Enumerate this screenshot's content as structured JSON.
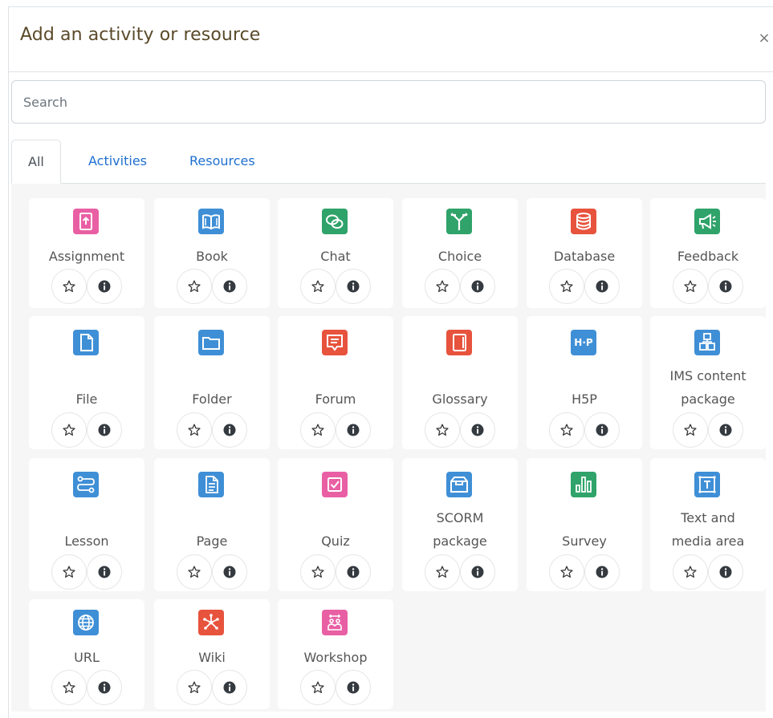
{
  "modal": {
    "title": "Add an activity or resource",
    "close_label": "×"
  },
  "search": {
    "placeholder": "Search",
    "value": ""
  },
  "tabs": [
    {
      "label": "All",
      "active": true
    },
    {
      "label": "Activities",
      "active": false
    },
    {
      "label": "Resources",
      "active": false
    }
  ],
  "colors": {
    "pink": "#e95fa4",
    "blue": "#3f8fd6",
    "green": "#2fa36a",
    "red": "#e7533d",
    "link": "#1f6fd1"
  },
  "modules": [
    {
      "name": "Assignment",
      "icon": "assignment-icon",
      "color": "#e95fa4"
    },
    {
      "name": "Book",
      "icon": "book-icon",
      "color": "#3f8fd6"
    },
    {
      "name": "Chat",
      "icon": "chat-icon",
      "color": "#2fa36a"
    },
    {
      "name": "Choice",
      "icon": "choice-icon",
      "color": "#2fa36a"
    },
    {
      "name": "Database",
      "icon": "database-icon",
      "color": "#e7533d"
    },
    {
      "name": "Feedback",
      "icon": "feedback-icon",
      "color": "#2fa36a"
    },
    {
      "name": "File",
      "icon": "file-icon",
      "color": "#3f8fd6"
    },
    {
      "name": "Folder",
      "icon": "folder-icon",
      "color": "#3f8fd6"
    },
    {
      "name": "Forum",
      "icon": "forum-icon",
      "color": "#e7533d"
    },
    {
      "name": "Glossary",
      "icon": "glossary-icon",
      "color": "#e7533d"
    },
    {
      "name": "H5P",
      "icon": "h5p-icon",
      "color": "#3f8fd6",
      "glyph": "H·P"
    },
    {
      "name": "IMS content package",
      "line1": "IMS content",
      "line2": "package",
      "icon": "ims-package-icon",
      "color": "#3f8fd6"
    },
    {
      "name": "Lesson",
      "icon": "lesson-icon",
      "color": "#3f8fd6"
    },
    {
      "name": "Page",
      "icon": "page-icon",
      "color": "#3f8fd6"
    },
    {
      "name": "Quiz",
      "icon": "quiz-icon",
      "color": "#e95fa4"
    },
    {
      "name": "SCORM package",
      "line1": "SCORM",
      "line2": "package",
      "icon": "scorm-icon",
      "color": "#3f8fd6"
    },
    {
      "name": "Survey",
      "icon": "survey-icon",
      "color": "#2fa36a"
    },
    {
      "name": "Text and media area",
      "line1": "Text and",
      "line2": "media area",
      "icon": "text-media-icon",
      "color": "#3f8fd6"
    },
    {
      "name": "URL",
      "icon": "url-icon",
      "color": "#3f8fd6"
    },
    {
      "name": "Wiki",
      "icon": "wiki-icon",
      "color": "#e7533d"
    },
    {
      "name": "Workshop",
      "icon": "workshop-icon",
      "color": "#e95fa4"
    }
  ],
  "actions": {
    "star_icon": "star-icon",
    "info_icon": "info-icon"
  }
}
